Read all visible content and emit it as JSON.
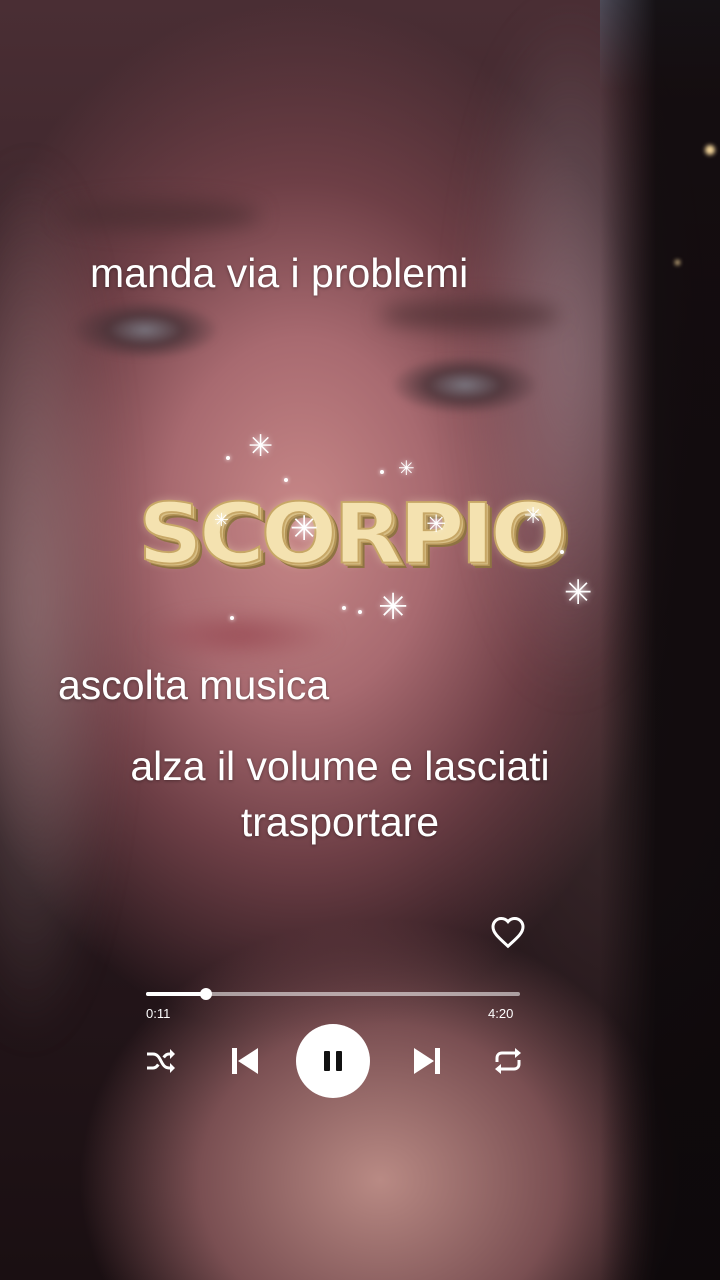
{
  "captions": {
    "line1": "manda via i problemi",
    "line2": "ascolta musica",
    "line3": "alza il volume e lasciati trasportare"
  },
  "sticker": {
    "word": "SCORPIO",
    "color": "#f4e2b0"
  },
  "player": {
    "elapsed": "0:11",
    "total": "4:20",
    "progress": 0.16,
    "state": "playing",
    "icons": {
      "like": "heart-icon",
      "shuffle": "shuffle-icon",
      "previous": "skip-previous-icon",
      "play_pause": "pause-icon",
      "next": "skip-next-icon",
      "repeat": "repeat-icon"
    }
  }
}
